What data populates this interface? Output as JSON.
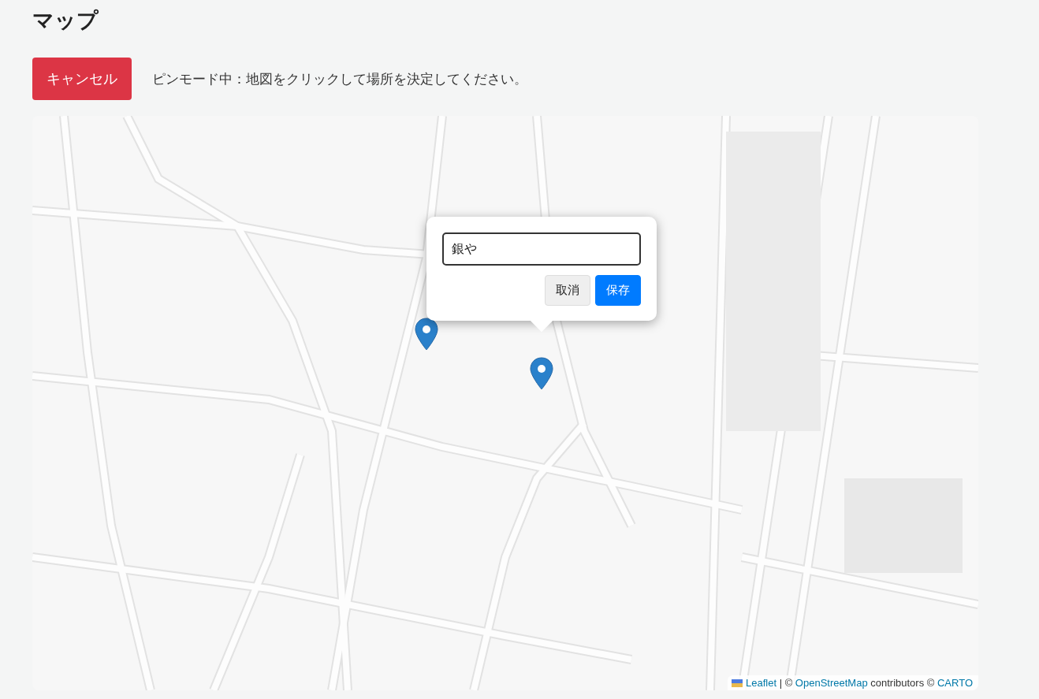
{
  "title": "マップ",
  "cancel_button": "キャンセル",
  "mode_message": "ピンモード中：地図をクリックして場所を決定してください。",
  "map": {
    "popup": {
      "input_value": "銀や",
      "buttons": [
        {
          "label": "取消",
          "kind": "secondary"
        },
        {
          "label": "保存",
          "kind": "primary"
        }
      ]
    },
    "attribution": {
      "parts": [
        {
          "kind": "link",
          "text": "Leaflet"
        },
        {
          "kind": "text",
          "text": " | © "
        },
        {
          "kind": "link",
          "text": "OpenStreetMap"
        },
        {
          "kind": "text",
          "text": " contributors © "
        },
        {
          "kind": "link",
          "text": "CARTO"
        }
      ]
    }
  }
}
